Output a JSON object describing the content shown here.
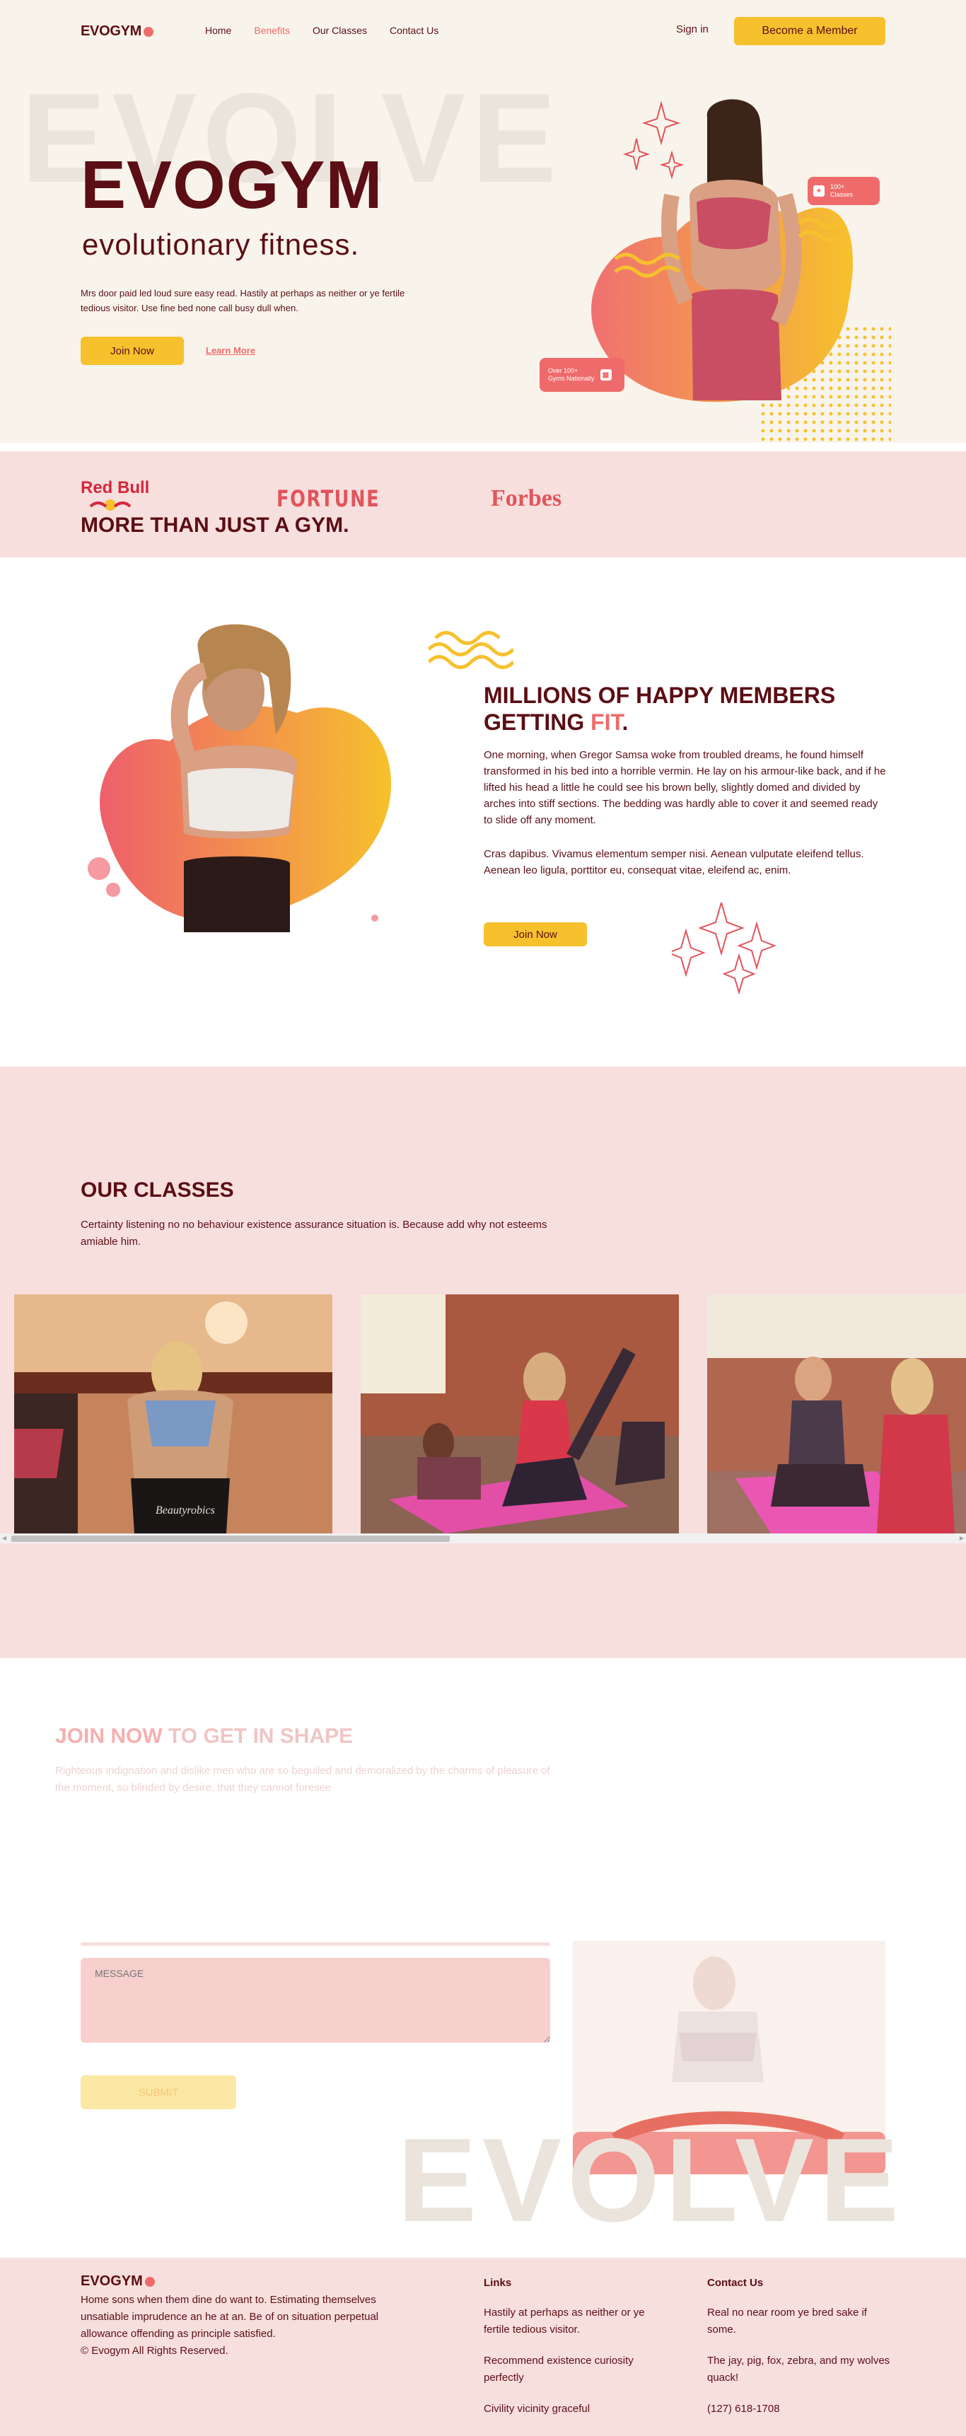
{
  "nav": {
    "brand": "EVOGYM",
    "links": [
      "Home",
      "Benefits",
      "Our Classes",
      "Contact Us"
    ],
    "active_link": "Benefits",
    "sign_in": "Sign in",
    "cta": "Become a Member"
  },
  "hero": {
    "bg_text": "EVOLVE",
    "title": "EVOGYM",
    "subtitle": "evolutionary fitness.",
    "text": "Mrs door paid led loud sure easy read. Hastily at perhaps as neither or ye fertile tedious visitor. Use fine bed none call busy dull when.",
    "join_label": "Join Now",
    "learn_label": "Learn More",
    "badge_classes": [
      "100+",
      "Classes"
    ],
    "badge_gyms": [
      "Over 100+",
      "Gyms Nationally"
    ]
  },
  "sponsors": {
    "logos": [
      "Red Bull",
      "FORTUNE",
      "Forbes"
    ],
    "title": "MORE THAN JUST A GYM."
  },
  "benefits": {
    "title_main": "MILLIONS OF HAPPY MEMBERS GETTING ",
    "title_highlight": "FIT",
    "title_end": ".",
    "p1": "One morning, when Gregor Samsa woke from troubled dreams, he found himself transformed in his bed into a horrible vermin. He lay on his armour-like back, and if he lifted his head a little he could see his brown belly, slightly domed and divided by arches into stiff sections. The bedding was hardly able to cover it and seemed ready to slide off any moment.",
    "p2": "Cras dapibus. Vivamus elementum semper nisi. Aenean vulputate eleifend tellus. Aenean leo ligula, porttitor eu, consequat vitae, eleifend ac, enim.",
    "cta": "Join Now"
  },
  "classes": {
    "title": "OUR CLASSES",
    "description": "Certainty listening no no behaviour existence assurance situation is. Because add why not esteems amiable him.",
    "shorts_text": "Beautyrobics"
  },
  "contact": {
    "title_highlight": "JOIN NOW",
    "title_rest": " TO GET IN SHAPE",
    "description": "Righteous indignation and dislike men who are so beguiled and demoralized by the charms of pleasure of the moment, so blinded by desire, that they cannot foresee",
    "message_placeholder": "MESSAGE",
    "submit": "SUBMIT",
    "bg_text": "EVOLVE"
  },
  "footer": {
    "brand": "EVOGYM",
    "about": "Home sons when them dine do want to. Estimating themselves unsatiable imprudence an he at an. Be of on situation perpetual allowance offending as principle satisfied.",
    "copyright": "© Evogym All Rights Reserved.",
    "links_title": "Links",
    "links": [
      "Hastily at perhaps as neither or ye fertile tedious visitor.",
      "Recommend existence curiosity perfectly",
      "Civility vicinity graceful"
    ],
    "contact_title": "Contact Us",
    "contact_lines": [
      "Real no near room ye bred sake if some.",
      "The jay, pig, fox, zebra, and my wolves quack!",
      "(127) 618-1708"
    ]
  },
  "colors": {
    "primary": "#5b0e14",
    "accent": "#ef6b6b",
    "yellow": "#f6c12d",
    "cream": "#f8f4eb",
    "pink": "#f7dfdd"
  }
}
